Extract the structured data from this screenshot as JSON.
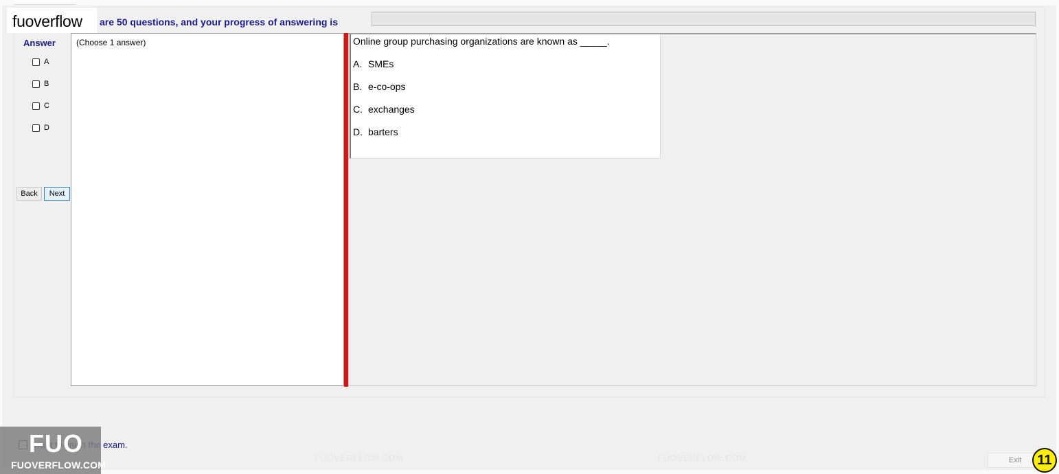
{
  "brand": {
    "name": "fuoverflow"
  },
  "header": {
    "progress_text": "are 50 questions, and your progress of answering is",
    "progress_fraction": 0
  },
  "answer_panel": {
    "title": "Answer",
    "options": [
      {
        "letter": "A",
        "checked": false
      },
      {
        "letter": "B",
        "checked": false
      },
      {
        "letter": "C",
        "checked": false
      },
      {
        "letter": "D",
        "checked": false
      }
    ],
    "back_label": "Back",
    "next_label": "Next"
  },
  "left_pane": {
    "instruction": "(Choose 1 answer)"
  },
  "question": {
    "text": "Online group purchasing organizations are known as _____.",
    "options": [
      {
        "letter": "A.",
        "text": "SMEs"
      },
      {
        "letter": "B.",
        "text": "e-co-ops"
      },
      {
        "letter": "C.",
        "text": "exchanges"
      },
      {
        "letter": "D.",
        "text": "barters"
      }
    ]
  },
  "footer": {
    "finish_label": "want to finish the exam.",
    "exit_label": "Exit",
    "page_number": "11"
  },
  "logo": {
    "big": "FUO",
    "small": "FUOVERFLOW.COM"
  },
  "watermark_text": "FUOVERFLOW.COM",
  "colors": {
    "accent_text": "#1a1a8c",
    "splitter": "#d4161b",
    "badge": "#ffee00"
  }
}
